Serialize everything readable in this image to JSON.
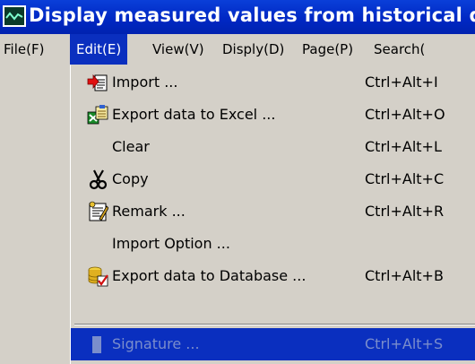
{
  "window": {
    "title": "Display measured values from historical d"
  },
  "menubar": {
    "items": [
      {
        "label": "File(F)"
      },
      {
        "label": "Edit(E)",
        "active": true
      },
      {
        "label": "View(V)"
      },
      {
        "label": "Disply(D)"
      },
      {
        "label": "Page(P)"
      },
      {
        "label": "Search("
      }
    ]
  },
  "edit_menu": {
    "items": [
      {
        "label": "Import ...",
        "shortcut": "Ctrl+Alt+I",
        "icon": "import-icon"
      },
      {
        "label": "Export data to Excel ...",
        "shortcut": "Ctrl+Alt+O",
        "icon": "excel-export-icon"
      },
      {
        "label": "Clear",
        "shortcut": "Ctrl+Alt+L",
        "icon": ""
      },
      {
        "label": "Copy",
        "shortcut": "Ctrl+Alt+C",
        "icon": "scissors-icon"
      },
      {
        "label": "Remark ...",
        "shortcut": "Ctrl+Alt+R",
        "icon": "remark-icon"
      },
      {
        "label": "Import Option ...",
        "shortcut": "",
        "icon": ""
      },
      {
        "label": "Export data to Database ...",
        "shortcut": "Ctrl+Alt+B",
        "icon": "database-export-icon"
      },
      {
        "label": "Signature ...",
        "shortcut": "Ctrl+Alt+S",
        "icon": "signature-icon",
        "state": "highlighted-disabled"
      }
    ]
  },
  "colors": {
    "titlebar": "#0028c4",
    "menu_background": "#d4d0c8",
    "highlight": "#0a2fbf",
    "disabled_on_highlight": "#7a8dcc"
  }
}
